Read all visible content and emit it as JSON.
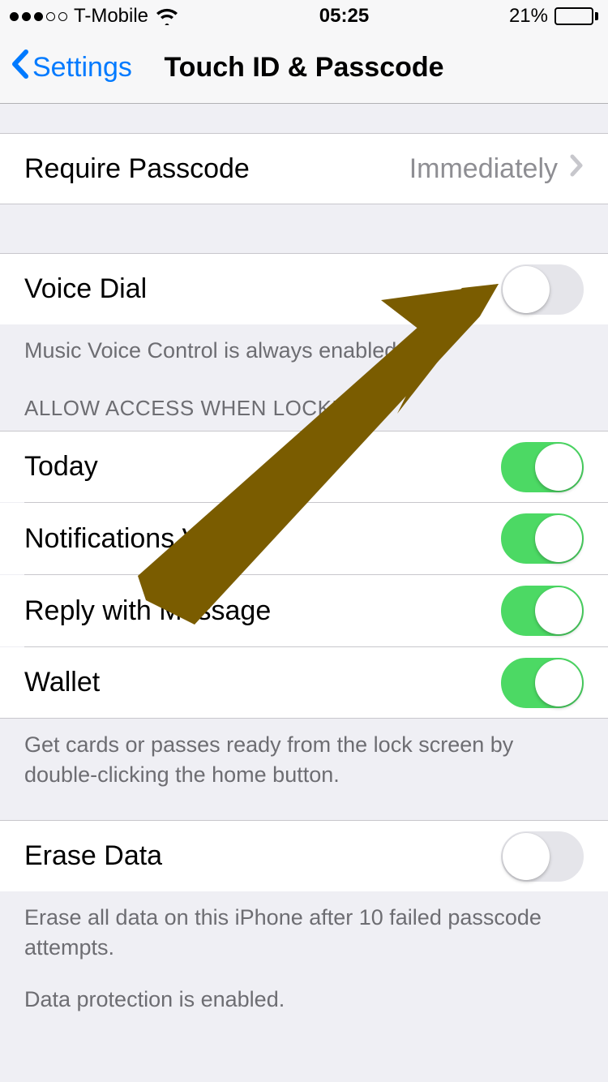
{
  "statusbar": {
    "carrier": "T-Mobile",
    "time": "05:25",
    "battery_pct": "21%"
  },
  "nav": {
    "back_label": "Settings",
    "title": "Touch ID & Passcode"
  },
  "require_passcode": {
    "label": "Require Passcode",
    "value": "Immediately"
  },
  "voice_dial": {
    "label": "Voice Dial",
    "footer": "Music Voice Control is always enabled.",
    "on": false
  },
  "allow_access": {
    "header": "ALLOW ACCESS WHEN LOCKED:",
    "items": [
      {
        "label": "Today",
        "on": true
      },
      {
        "label": "Notifications View",
        "on": true
      },
      {
        "label": "Reply with Message",
        "on": true
      },
      {
        "label": "Wallet",
        "on": true
      }
    ],
    "footer": "Get cards or passes ready from the lock screen by double-clicking the home button."
  },
  "erase_data": {
    "label": "Erase Data",
    "on": false,
    "footer1": "Erase all data on this iPhone after 10 failed passcode attempts.",
    "footer2": "Data protection is enabled."
  },
  "annotation": {
    "arrow_color": "#7a5c00"
  }
}
